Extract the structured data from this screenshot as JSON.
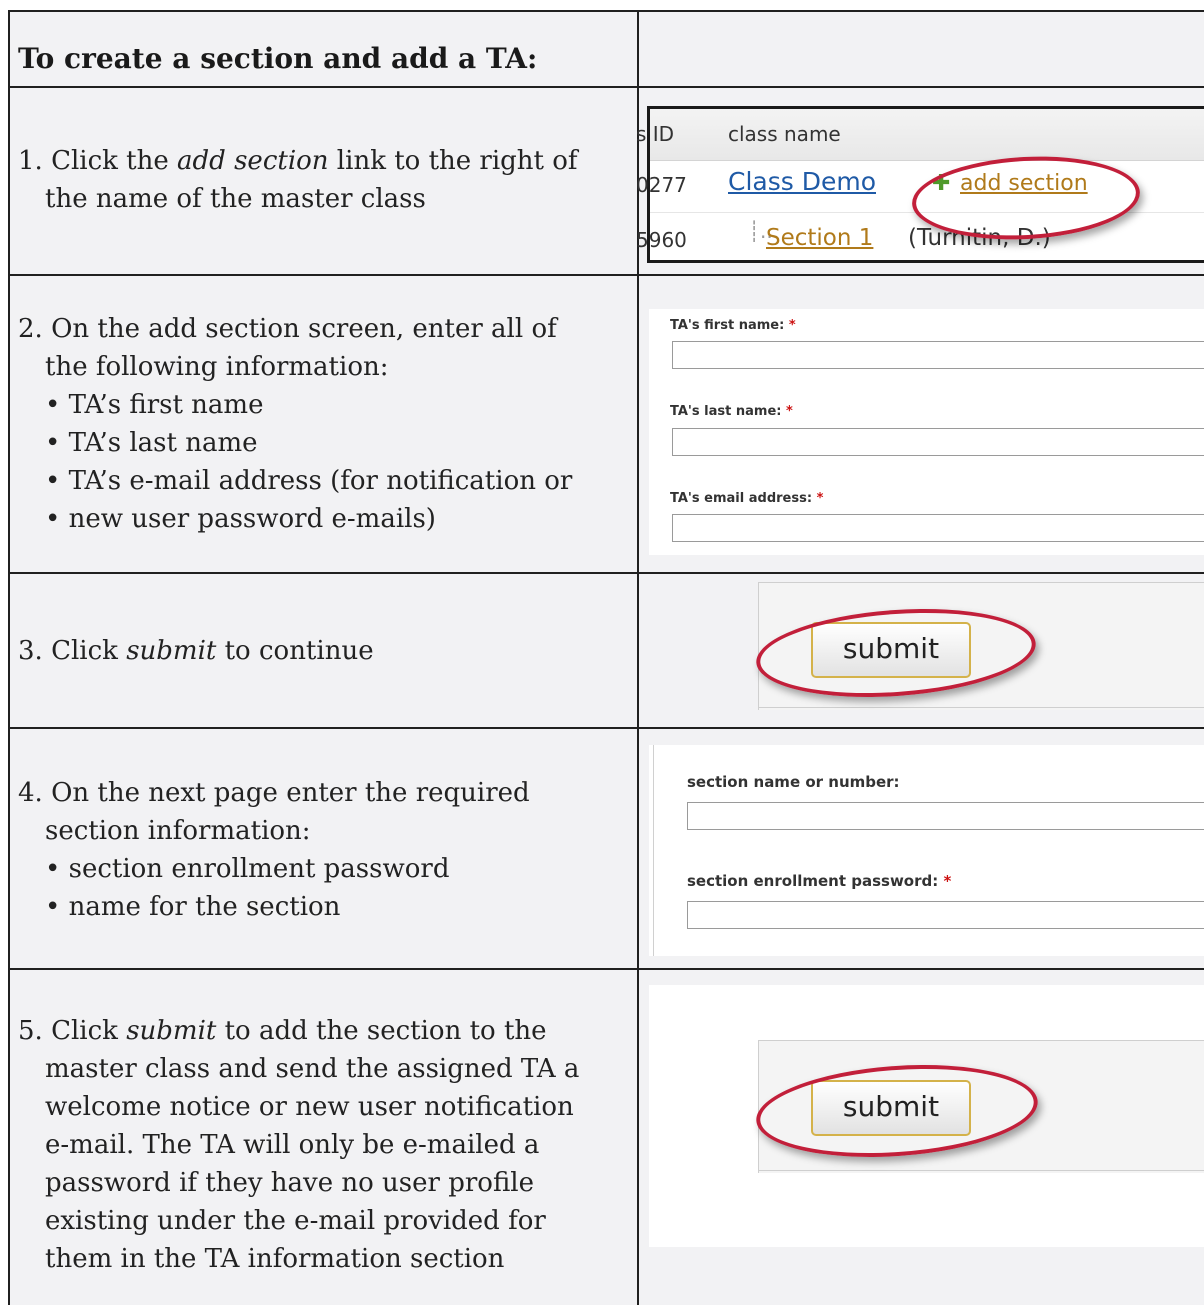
{
  "header": {
    "title": "To create a section and add a TA:"
  },
  "steps": [
    {
      "number": "1.",
      "text_before": "Click the ",
      "emph": "add section",
      "text_after": " link to the right of",
      "line2": "the name of the master class"
    },
    {
      "number": "2.",
      "line1": "On the add section screen, enter all of",
      "line2": "the following information:",
      "bullets": [
        "• TA’s first name",
        "• TA’s last name",
        "• TA’s e-mail address (for notification or",
        "• new user password e-mails)"
      ]
    },
    {
      "number": "3.",
      "text_before": "Click ",
      "emph": "submit",
      "text_after": " to continue"
    },
    {
      "number": "4.",
      "line1": "On the next page enter the required",
      "line2": "section information:",
      "bullets": [
        "• section enrollment password",
        "• name for the section"
      ]
    },
    {
      "number": "5.",
      "text_before": "Click ",
      "emph": "submit",
      "text_after": " to add the section to the",
      "lines": [
        "master class and send the assigned TA a",
        "welcome notice or new user notification",
        "e-mail. The TA will only be e-mailed a",
        "password if they have no user profile",
        "existing under the e-mail provided for",
        "them in the TA information section"
      ]
    }
  ],
  "shot1": {
    "col_id": "s ID",
    "col_name": "class name",
    "row1_id": "0277",
    "row1_class": "Class Demo",
    "add_icon": "plus-icon",
    "add_link": "add section",
    "row2_id": "5960",
    "row2_section": "Section 1",
    "row2_instructor": "(Turnitin, D.)"
  },
  "form2": {
    "first_label": "TA's first name:",
    "last_label": "TA's last name:",
    "email_label": "TA's email address:",
    "required_mark": "*"
  },
  "submit_label": "submit",
  "form4": {
    "name_label": "section name or number:",
    "password_label": "section enrollment password:",
    "required_mark": "*"
  },
  "colors": {
    "border": "#202020",
    "cell_bg": "#f2f2f4",
    "oval": "#c21f3a",
    "link_blue": "#1f5aa6",
    "link_orange": "#b8860b",
    "plus_green": "#4f9a2a",
    "required_red": "#cc1111"
  }
}
